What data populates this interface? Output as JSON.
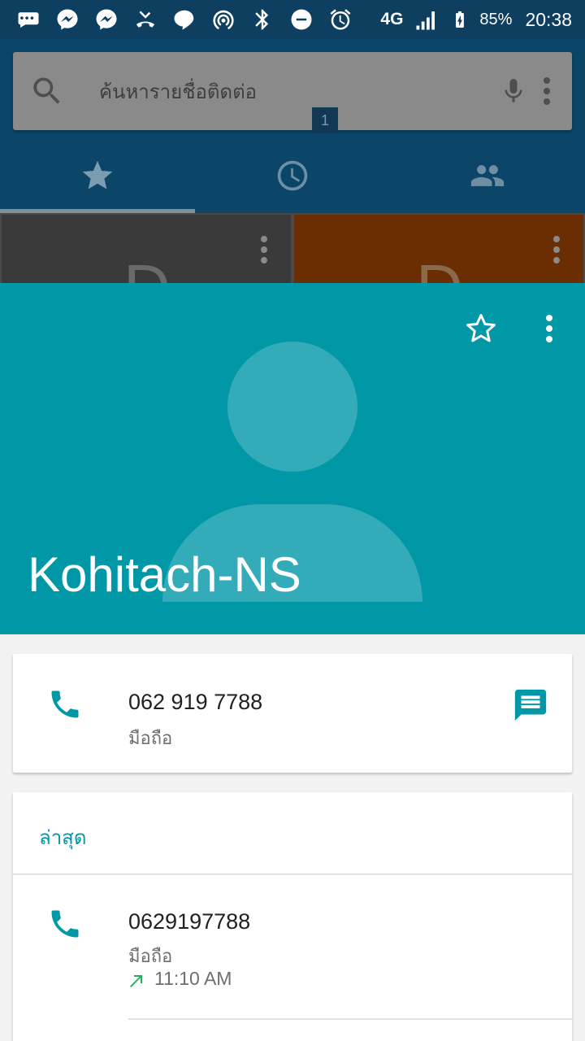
{
  "status_bar": {
    "network": "4G",
    "battery": "85%",
    "time": "20:38"
  },
  "search": {
    "placeholder": "ค้นหารายชื่อติดต่อ"
  },
  "tabs": {
    "recents_badge": "1"
  },
  "favorites": {
    "cards": [
      {
        "letter": "D",
        "color": "#3a3a3a"
      },
      {
        "letter": "D",
        "color": "#6a2e02"
      }
    ]
  },
  "contact": {
    "name": "Kohitach-NS",
    "header_color": "#0097a7"
  },
  "phone_entry": {
    "number": "062 919 7788",
    "type": "มือถือ"
  },
  "recent": {
    "title": "ล่าสุด",
    "entries": [
      {
        "number": "0629197788",
        "type": "มือถือ",
        "time": "11:10 AM",
        "direction": "outgoing"
      }
    ]
  },
  "colors": {
    "accent": "#0097a7",
    "status_bar": "#0e3f60",
    "outgoing_arrow": "#2eab60"
  }
}
